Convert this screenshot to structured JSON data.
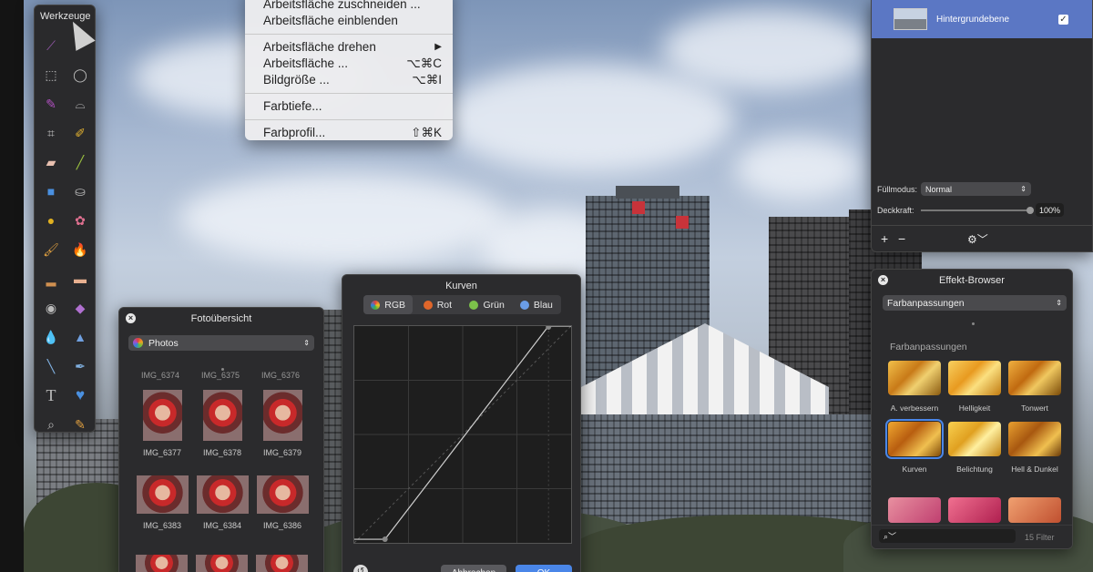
{
  "tools_panel": {
    "title": "Werkzeuge"
  },
  "menu": {
    "items": [
      {
        "label": "Arbeitsfläche zuschneiden ...",
        "shortcut": ""
      },
      {
        "label": "Arbeitsfläche einblenden",
        "shortcut": ""
      },
      {
        "label": "Arbeitsfläche drehen",
        "shortcut": "▶"
      },
      {
        "label": "Arbeitsfläche ...",
        "shortcut": "⌥⌘C"
      },
      {
        "label": "Bildgröße ...",
        "shortcut": "⌥⌘I"
      },
      {
        "label": "Farbtiefe...",
        "shortcut": ""
      },
      {
        "label": "Farbprofil...",
        "shortcut": "⇧⌘K"
      }
    ]
  },
  "layers": {
    "layer_name": "Hintergrundebene",
    "fill_mode_label": "Füllmodus:",
    "fill_mode_value": "Normal",
    "opacity_label": "Deckkraft:",
    "opacity_value": "100%",
    "opacity_fraction": 1.0,
    "add": "+",
    "remove": "−"
  },
  "effects": {
    "title": "Effekt-Browser",
    "category_select": "Farbanpassungen",
    "section_title": "Farbanpassungen",
    "items": [
      {
        "label": "A. verbessern"
      },
      {
        "label": "Helligkeit"
      },
      {
        "label": "Tonwert"
      },
      {
        "label": "Kurven"
      },
      {
        "label": "Belichtung"
      },
      {
        "label": "Hell & Dunkel"
      }
    ],
    "filter_count": "15 Filter"
  },
  "photos": {
    "title": "Fotoübersicht",
    "source": "Photos",
    "top_labels": [
      "IMG_6374",
      "IMG_6375",
      "IMG_6376"
    ],
    "items": [
      {
        "label": "IMG_6377"
      },
      {
        "label": "IMG_6378"
      },
      {
        "label": "IMG_6379"
      },
      {
        "label": "IMG_6383"
      },
      {
        "label": "IMG_6384"
      },
      {
        "label": "IMG_6386"
      }
    ]
  },
  "curves": {
    "title": "Kurven",
    "channels": [
      {
        "label": "RGB",
        "color": "#3f8ee0"
      },
      {
        "label": "Rot",
        "color": "#e0662a"
      },
      {
        "label": "Grün",
        "color": "#7cc24a"
      },
      {
        "label": "Blau",
        "color": "#6a9de8"
      }
    ],
    "cancel": "Abbrechen",
    "ok": "OK"
  },
  "colors": {
    "accent": "#4a86e8",
    "selection": "#5b77c4"
  }
}
